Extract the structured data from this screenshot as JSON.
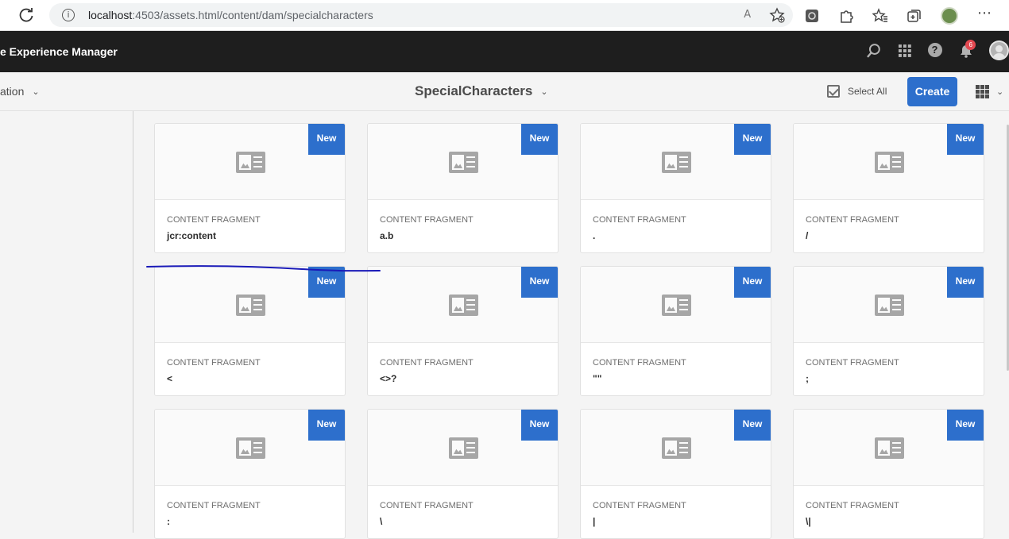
{
  "browser": {
    "url_host": "localhost",
    "url_rest": ":4503/assets.html/content/dam/specialcharacters",
    "read_aloud_glyph": "A ⁲"
  },
  "header": {
    "product_title": "e Experience Manager",
    "notification_count": "6",
    "help_glyph": "?"
  },
  "actionbar": {
    "rail_label": "ation",
    "folder_title": "SpecialCharacters",
    "select_all_label": "Select All",
    "create_label": "Create"
  },
  "cards": [
    {
      "type": "CONTENT FRAGMENT",
      "name": "jcr:content",
      "badge": "New"
    },
    {
      "type": "CONTENT FRAGMENT",
      "name": "a.b",
      "badge": "New"
    },
    {
      "type": "CONTENT FRAGMENT",
      "name": ".",
      "badge": "New"
    },
    {
      "type": "CONTENT FRAGMENT",
      "name": "/",
      "badge": "New"
    },
    {
      "type": "CONTENT FRAGMENT",
      "name": "<",
      "badge": "New"
    },
    {
      "type": "CONTENT FRAGMENT",
      "name": "<>?",
      "badge": "New"
    },
    {
      "type": "CONTENT FRAGMENT",
      "name": "\"\"",
      "badge": "New"
    },
    {
      "type": "CONTENT FRAGMENT",
      "name": ";",
      "badge": "New"
    },
    {
      "type": "CONTENT FRAGMENT",
      "name": ":",
      "badge": "New"
    },
    {
      "type": "CONTENT FRAGMENT",
      "name": "\\",
      "badge": "New"
    },
    {
      "type": "CONTENT FRAGMENT",
      "name": "|",
      "badge": "New"
    },
    {
      "type": "CONTENT FRAGMENT",
      "name": "\\|",
      "badge": "New"
    }
  ],
  "colors": {
    "accent": "#2d6fcc",
    "header_bg": "#1e1e1e",
    "annotation_stroke": "#1a1ab8",
    "notification_badge": "#e34850"
  }
}
